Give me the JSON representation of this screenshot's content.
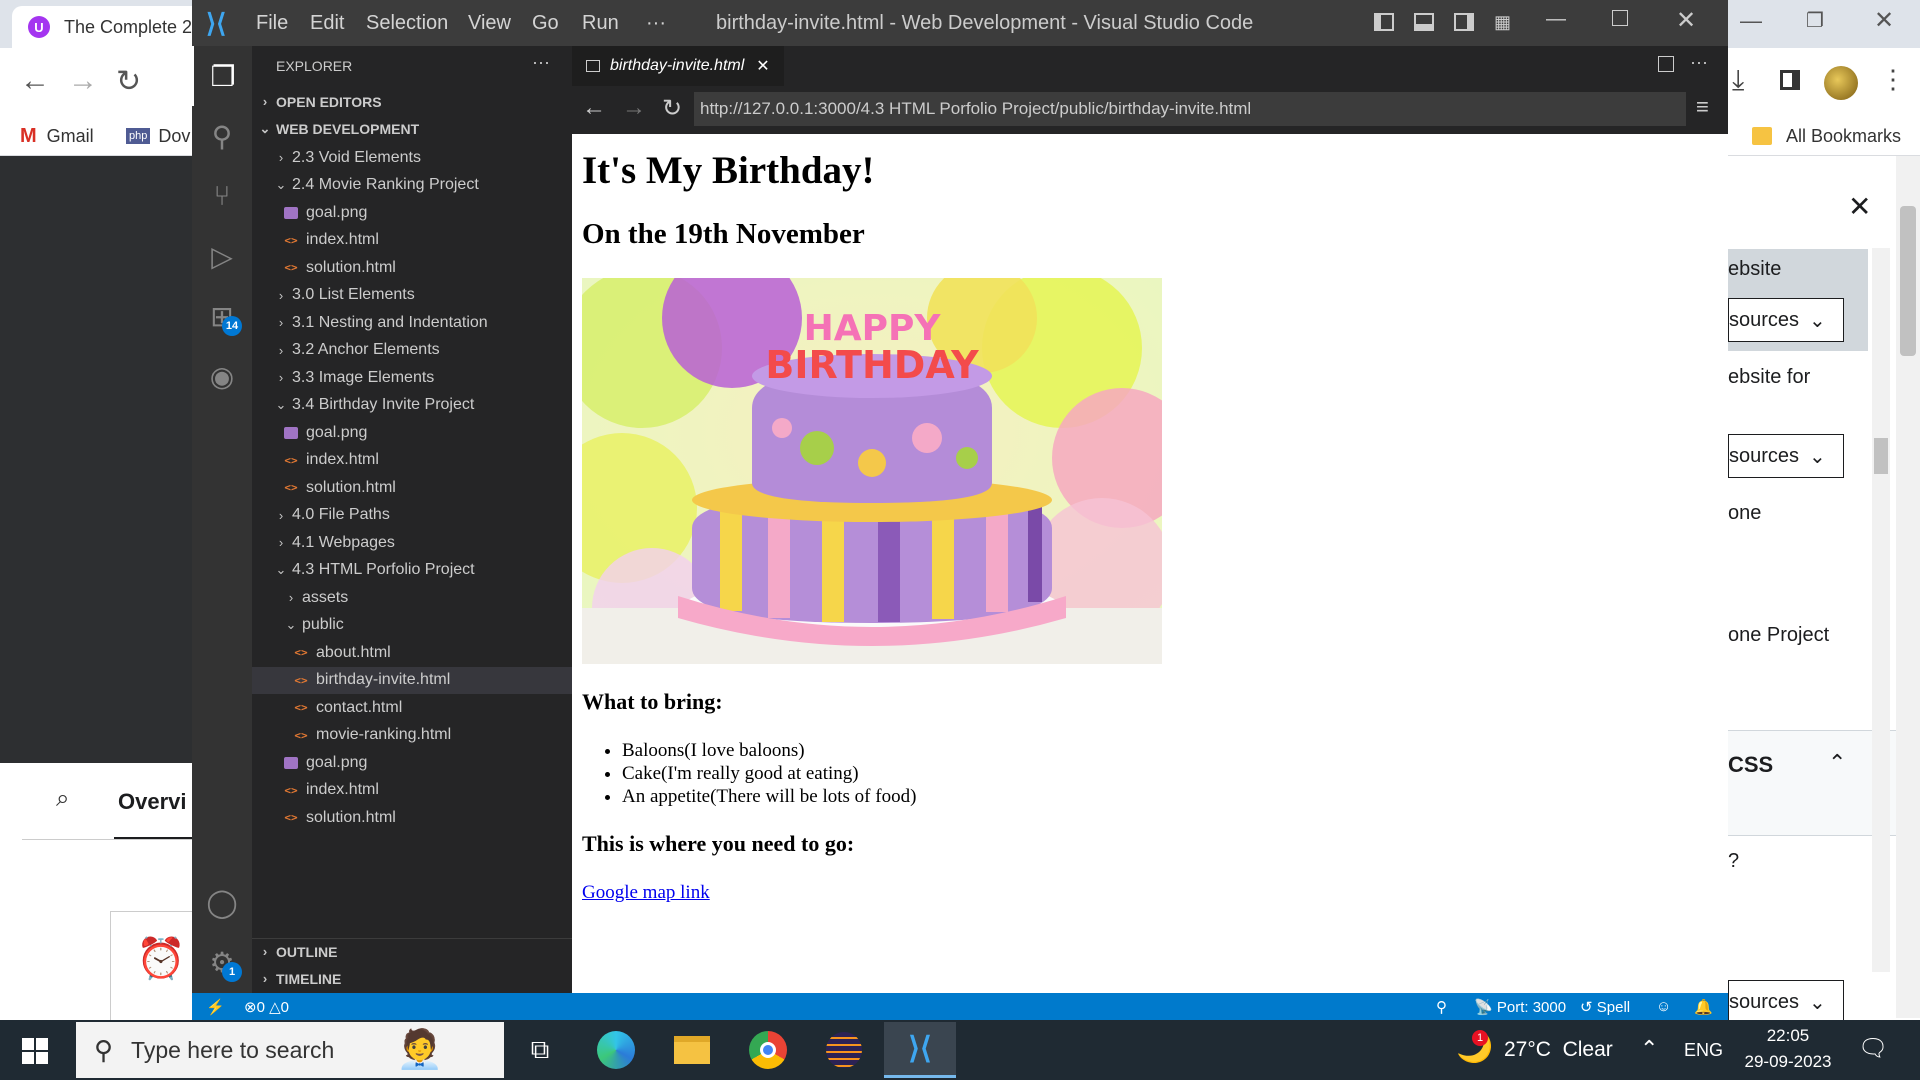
{
  "chrome": {
    "tab_title": "The Complete 2",
    "bookmarks": [
      "Gmail",
      "Dov"
    ],
    "all_bookmarks": "All Bookmarks",
    "left_tab": "Overvi",
    "right_panel": {
      "items": [
        "ebsite",
        "sources",
        "ebsite for",
        "sources",
        "one",
        "one Project",
        "CSS",
        "?",
        "sources"
      ]
    }
  },
  "vscode": {
    "title": "birthday-invite.html - Web Development - Visual Studio Code",
    "menu": [
      "File",
      "Edit",
      "Selection",
      "View",
      "Go",
      "Run",
      "···"
    ],
    "explorer_label": "EXPLORER",
    "sections": {
      "open_editors": "OPEN EDITORS",
      "workspace": "WEB DEVELOPMENT",
      "outline": "OUTLINE",
      "timeline": "TIMELINE"
    },
    "extensions_badge": "14",
    "settings_badge": "1",
    "tree": [
      {
        "label": "2.3 Void Elements",
        "type": "folder",
        "open": false,
        "depth": 1
      },
      {
        "label": "2.4 Movie Ranking Project",
        "type": "folder",
        "open": true,
        "depth": 1
      },
      {
        "label": "goal.png",
        "type": "png",
        "depth": 2
      },
      {
        "label": "index.html",
        "type": "html",
        "depth": 2
      },
      {
        "label": "solution.html",
        "type": "html",
        "depth": 2
      },
      {
        "label": "3.0 List Elements",
        "type": "folder",
        "open": false,
        "depth": 1
      },
      {
        "label": "3.1 Nesting and Indentation",
        "type": "folder",
        "open": false,
        "depth": 1
      },
      {
        "label": "3.2 Anchor Elements",
        "type": "folder",
        "open": false,
        "depth": 1
      },
      {
        "label": "3.3 Image Elements",
        "type": "folder",
        "open": false,
        "depth": 1
      },
      {
        "label": "3.4 Birthday Invite Project",
        "type": "folder",
        "open": true,
        "depth": 1
      },
      {
        "label": "goal.png",
        "type": "png",
        "depth": 2
      },
      {
        "label": "index.html",
        "type": "html",
        "depth": 2
      },
      {
        "label": "solution.html",
        "type": "html",
        "depth": 2
      },
      {
        "label": "4.0 File Paths",
        "type": "folder",
        "open": false,
        "depth": 1
      },
      {
        "label": "4.1 Webpages",
        "type": "folder",
        "open": false,
        "depth": 1
      },
      {
        "label": "4.3 HTML Porfolio Project",
        "type": "folder",
        "open": true,
        "depth": 1
      },
      {
        "label": "assets",
        "type": "folder",
        "open": false,
        "depth": 2
      },
      {
        "label": "public",
        "type": "folder",
        "open": true,
        "depth": 2
      },
      {
        "label": "about.html",
        "type": "html",
        "depth": 3
      },
      {
        "label": "birthday-invite.html",
        "type": "html",
        "depth": 3,
        "selected": true
      },
      {
        "label": "contact.html",
        "type": "html",
        "depth": 3
      },
      {
        "label": "movie-ranking.html",
        "type": "html",
        "depth": 3
      },
      {
        "label": "goal.png",
        "type": "png",
        "depth": 2
      },
      {
        "label": "index.html",
        "type": "html",
        "depth": 2
      },
      {
        "label": "solution.html",
        "type": "html",
        "depth": 2
      }
    ],
    "editor_tab": "birthday-invite.html",
    "url": "http://127.0.0.1:3000/4.3 HTML Porfolio Project/public/birthday-invite.html",
    "status": {
      "errors": "0",
      "warnings": "0",
      "port": "Port: 3000",
      "spell": "Spell"
    }
  },
  "preview": {
    "h1": "It's My Birthday!",
    "h2": "On the 19th November",
    "image_text_1": "HAPPY",
    "image_text_2": "BIRTHDAY",
    "bring_heading": "What to bring:",
    "bring_items": [
      "Baloons(I love baloons)",
      "Cake(I'm really good at eating)",
      "An appetite(There will be lots of food)"
    ],
    "go_heading": "This is where you need to go:",
    "link": "Google map link"
  },
  "taskbar": {
    "search_placeholder": "Type here to search",
    "weather": "27°C  Clear",
    "weather_badge": "1",
    "lang": "ENG",
    "time": "22:05",
    "date": "29-09-2023"
  },
  "colors": {
    "vscode_blue": "#007acc",
    "html_icon": "#e37933",
    "link": "#0000ee"
  }
}
